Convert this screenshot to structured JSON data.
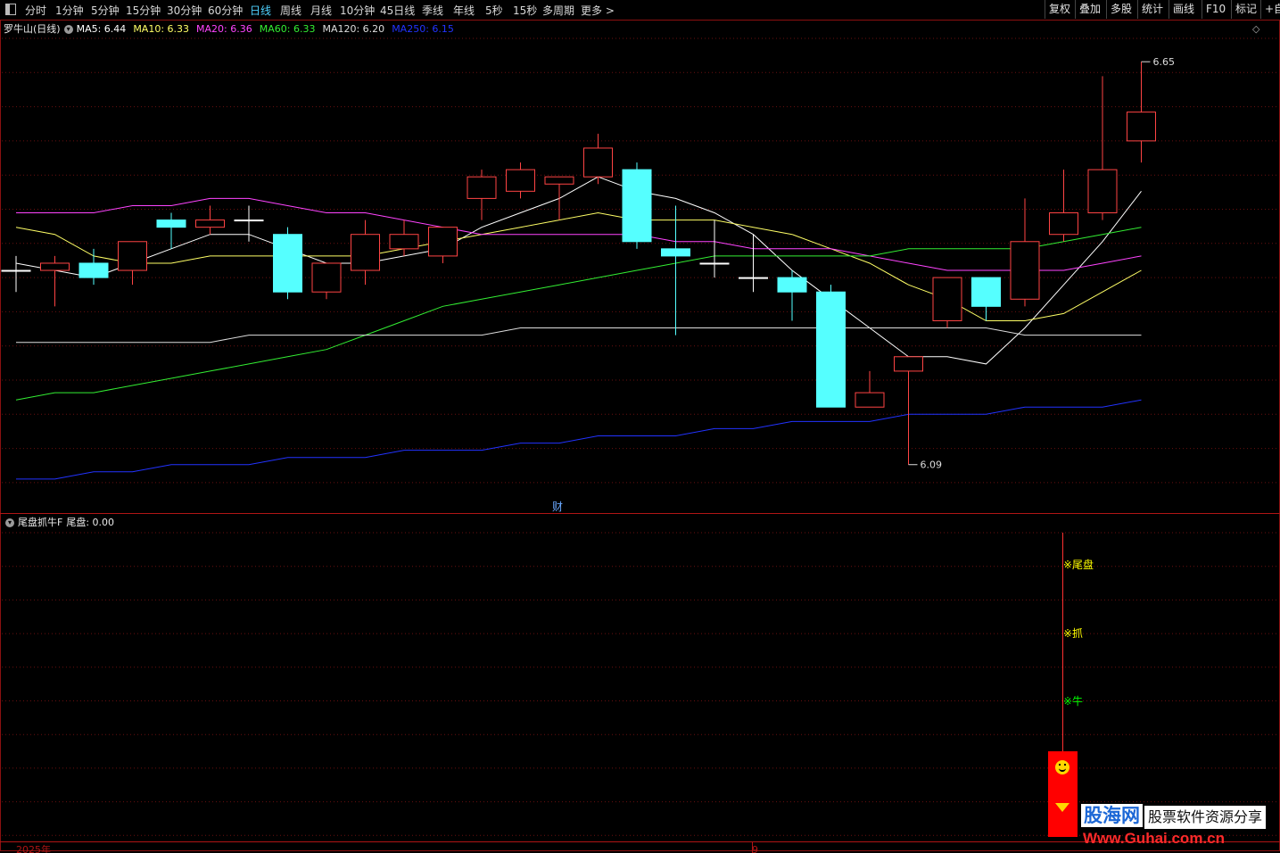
{
  "toolbar": {
    "periods": [
      {
        "label": "分时",
        "active": false
      },
      {
        "label": "1分钟",
        "active": false
      },
      {
        "label": "5分钟",
        "active": false
      },
      {
        "label": "15分钟",
        "active": false
      },
      {
        "label": "30分钟",
        "active": false
      },
      {
        "label": "60分钟",
        "active": false
      },
      {
        "label": "日线",
        "active": true
      },
      {
        "label": "周线",
        "active": false
      },
      {
        "label": "月线",
        "active": false
      },
      {
        "label": "10分钟",
        "active": false
      },
      {
        "label": "45日线",
        "active": false
      },
      {
        "label": "季线",
        "active": false
      },
      {
        "label": "年线",
        "active": false
      },
      {
        "label": "5秒",
        "active": false
      },
      {
        "label": "15秒",
        "active": false
      },
      {
        "label": "多周期",
        "active": false
      },
      {
        "label": "更多 >",
        "active": false
      }
    ],
    "right_buttons": [
      "复权",
      "叠加",
      "多股",
      "统计",
      "画线",
      "F10",
      "标记",
      "+自"
    ]
  },
  "main_chart": {
    "title": "罗牛山(日线)",
    "ma_legend": [
      {
        "label": "MA5: 6.44",
        "color": "#ffffff"
      },
      {
        "label": "MA10: 6.33",
        "color": "#ffff66"
      },
      {
        "label": "MA20: 6.36",
        "color": "#ff44ff"
      },
      {
        "label": "MA60: 6.33",
        "color": "#33ee33"
      },
      {
        "label": "MA120: 6.20",
        "color": "#dddddd"
      },
      {
        "label": "MA250: 6.15",
        "color": "#2233ff"
      }
    ],
    "high_label": "6.65",
    "low_label": "6.09",
    "marker_cai": "财"
  },
  "indicator": {
    "name": "尾盘抓牛F",
    "value_label": "尾盘: 0.00",
    "signal_labels": [
      {
        "text": "尾盘",
        "color": "#ffff00"
      },
      {
        "text": "抓",
        "color": "#ffff00"
      },
      {
        "text": "牛",
        "color": "#00ff00"
      }
    ]
  },
  "axis": {
    "year_label": "2025年",
    "month_label": "9"
  },
  "watermark": {
    "logo": "股海网",
    "tagline": "股票软件资源分享",
    "url": "Www.Guhai.com.cn"
  },
  "chart_data": {
    "type": "candlestick",
    "series": [
      {
        "open": 6.36,
        "high": 6.38,
        "low": 6.33,
        "close": 6.36
      },
      {
        "open": 6.36,
        "high": 6.38,
        "low": 6.31,
        "close": 6.37
      },
      {
        "open": 6.37,
        "high": 6.39,
        "low": 6.34,
        "close": 6.35
      },
      {
        "open": 6.36,
        "high": 6.39,
        "low": 6.34,
        "close": 6.4
      },
      {
        "open": 6.43,
        "high": 6.44,
        "low": 6.39,
        "close": 6.42
      },
      {
        "open": 6.42,
        "high": 6.45,
        "low": 6.41,
        "close": 6.43
      },
      {
        "open": 6.43,
        "high": 6.45,
        "low": 6.4,
        "close": 6.43
      },
      {
        "open": 6.41,
        "high": 6.42,
        "low": 6.32,
        "close": 6.33
      },
      {
        "open": 6.33,
        "high": 6.36,
        "low": 6.32,
        "close": 6.37
      },
      {
        "open": 6.36,
        "high": 6.43,
        "low": 6.34,
        "close": 6.41
      },
      {
        "open": 6.39,
        "high": 6.43,
        "low": 6.38,
        "close": 6.41
      },
      {
        "open": 6.38,
        "high": 6.41,
        "low": 6.37,
        "close": 6.42
      },
      {
        "open": 6.46,
        "high": 6.5,
        "low": 6.43,
        "close": 6.49
      },
      {
        "open": 6.47,
        "high": 6.51,
        "low": 6.46,
        "close": 6.5
      },
      {
        "open": 6.48,
        "high": 6.49,
        "low": 6.43,
        "close": 6.49
      },
      {
        "open": 6.49,
        "high": 6.55,
        "low": 6.48,
        "close": 6.53
      },
      {
        "open": 6.5,
        "high": 6.51,
        "low": 6.39,
        "close": 6.4
      },
      {
        "open": 6.39,
        "high": 6.45,
        "low": 6.27,
        "close": 6.38
      },
      {
        "open": 6.37,
        "high": 6.43,
        "low": 6.35,
        "close": 6.37
      },
      {
        "open": 6.35,
        "high": 6.41,
        "low": 6.33,
        "close": 6.35
      },
      {
        "open": 6.35,
        "high": 6.36,
        "low": 6.29,
        "close": 6.33
      },
      {
        "open": 6.33,
        "high": 6.34,
        "low": 6.18,
        "close": 6.17
      },
      {
        "open": 6.17,
        "high": 6.22,
        "low": 6.17,
        "close": 6.19
      },
      {
        "open": 6.22,
        "high": 6.23,
        "low": 6.09,
        "close": 6.24
      },
      {
        "open": 6.29,
        "high": 6.35,
        "low": 6.28,
        "close": 6.35
      },
      {
        "open": 6.35,
        "high": 6.35,
        "low": 6.29,
        "close": 6.31
      },
      {
        "open": 6.32,
        "high": 6.46,
        "low": 6.31,
        "close": 6.4
      },
      {
        "open": 6.41,
        "high": 6.5,
        "low": 6.4,
        "close": 6.44
      },
      {
        "open": 6.44,
        "high": 6.63,
        "low": 6.43,
        "close": 6.5
      },
      {
        "open": 6.54,
        "high": 6.65,
        "low": 6.51,
        "close": 6.58
      }
    ],
    "ma_lines": {
      "MA5": [
        6.37,
        6.36,
        6.35,
        6.37,
        6.39,
        6.41,
        6.41,
        6.39,
        6.37,
        6.37,
        6.38,
        6.39,
        6.42,
        6.44,
        6.46,
        6.49,
        6.47,
        6.46,
        6.44,
        6.41,
        6.36,
        6.32,
        6.28,
        6.24,
        6.24,
        6.23,
        6.28,
        6.34,
        6.4,
        6.47
      ],
      "MA10": [
        6.42,
        6.41,
        6.38,
        6.37,
        6.37,
        6.38,
        6.38,
        6.38,
        6.38,
        6.38,
        6.39,
        6.4,
        6.41,
        6.42,
        6.43,
        6.44,
        6.43,
        6.43,
        6.43,
        6.42,
        6.41,
        6.39,
        6.37,
        6.34,
        6.32,
        6.29,
        6.29,
        6.3,
        6.33,
        6.36
      ],
      "MA20": [
        6.44,
        6.44,
        6.44,
        6.45,
        6.45,
        6.46,
        6.46,
        6.45,
        6.44,
        6.44,
        6.43,
        6.42,
        6.41,
        6.41,
        6.41,
        6.41,
        6.41,
        6.4,
        6.4,
        6.39,
        6.39,
        6.39,
        6.38,
        6.37,
        6.36,
        6.36,
        6.36,
        6.36,
        6.37,
        6.38
      ],
      "MA60": [
        6.18,
        6.19,
        6.19,
        6.2,
        6.21,
        6.22,
        6.23,
        6.24,
        6.25,
        6.27,
        6.29,
        6.31,
        6.32,
        6.33,
        6.34,
        6.35,
        6.36,
        6.37,
        6.38,
        6.38,
        6.38,
        6.38,
        6.38,
        6.39,
        6.39,
        6.39,
        6.39,
        6.4,
        6.41,
        6.42
      ],
      "MA120": [
        6.26,
        6.26,
        6.26,
        6.26,
        6.26,
        6.26,
        6.27,
        6.27,
        6.27,
        6.27,
        6.27,
        6.27,
        6.27,
        6.28,
        6.28,
        6.28,
        6.28,
        6.28,
        6.28,
        6.28,
        6.28,
        6.28,
        6.28,
        6.28,
        6.28,
        6.28,
        6.27,
        6.27,
        6.27,
        6.27
      ],
      "MA250": [
        6.07,
        6.07,
        6.08,
        6.08,
        6.09,
        6.09,
        6.09,
        6.1,
        6.1,
        6.1,
        6.11,
        6.11,
        6.11,
        6.12,
        6.12,
        6.13,
        6.13,
        6.13,
        6.14,
        6.14,
        6.15,
        6.15,
        6.15,
        6.16,
        6.16,
        6.16,
        6.17,
        6.17,
        6.17,
        6.18
      ]
    },
    "ma_colors": {
      "MA5": "#ffffff",
      "MA10": "#ffff66",
      "MA20": "#ff44ff",
      "MA60": "#33ee33",
      "MA120": "#dddddd",
      "MA250": "#2233ff"
    },
    "up_color": "#ff4444",
    "down_color": "#55ffff",
    "ylim": [
      6.05,
      6.68
    ]
  }
}
